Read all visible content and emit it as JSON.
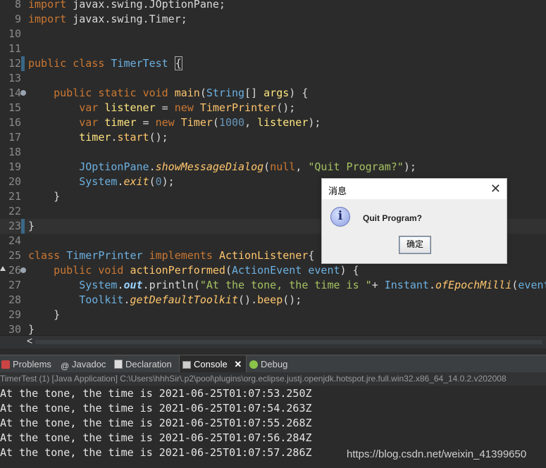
{
  "editor": {
    "lines": [
      {
        "num": "8"
      },
      {
        "num": "9"
      },
      {
        "num": "10"
      },
      {
        "num": "11"
      },
      {
        "num": "12"
      },
      {
        "num": "13"
      },
      {
        "num": "14"
      },
      {
        "num": "15"
      },
      {
        "num": "16"
      },
      {
        "num": "17"
      },
      {
        "num": "18"
      },
      {
        "num": "19"
      },
      {
        "num": "20"
      },
      {
        "num": "21"
      },
      {
        "num": "22"
      },
      {
        "num": "23"
      },
      {
        "num": "24"
      },
      {
        "num": "25"
      },
      {
        "num": "26"
      },
      {
        "num": "27"
      },
      {
        "num": "28"
      },
      {
        "num": "29"
      },
      {
        "num": "30"
      }
    ],
    "tokens": {
      "import": "import",
      "l8_rest": " javax.swing.JOptionPane;",
      "l9_rest": " javax.swing.Timer;",
      "public": "public",
      "class": "class",
      "TimerTest": "TimerTest",
      "brace_open_hl": "{",
      "static": "static",
      "void": "void",
      "main": "main",
      "String": "String",
      "args": "args",
      "var": "var",
      "listener": "listener",
      "new": "new",
      "TimerPrinter": "TimerPrinter",
      "timer": "timer",
      "Timer": "Timer",
      "n1000": "1000",
      "start": "start",
      "JOptionPane": "JOptionPane",
      "showMessageDialog": "showMessageDialog",
      "null": "null",
      "quit_str": "\"Quit Program?\"",
      "System": "System",
      "exit": "exit",
      "n0": "0",
      "implements": "implements",
      "ActionListener": "ActionListener",
      "actionPerformed": "actionPerformed",
      "ActionEvent": "ActionEvent",
      "event": "event",
      "out": "out",
      "println": "println",
      "tone_str": "\"At the tone, the time is \"",
      "Instant": "Instant",
      "ofEpochMilli": "ofEpochMilli",
      "event_trunc": "event",
      "Toolkit": "Toolkit",
      "getDefaultToolkit": "getDefaultToolkit",
      "beep": "beep"
    }
  },
  "scroll": {
    "left_arrow": "<"
  },
  "tabs": [
    {
      "label": "Problems",
      "icon": "problems-icon"
    },
    {
      "label": "Javadoc",
      "icon": "javadoc-icon"
    },
    {
      "label": "Declaration",
      "icon": "declaration-icon"
    },
    {
      "label": "Console",
      "icon": "console-icon",
      "active": true,
      "close": "✕"
    },
    {
      "label": "Debug",
      "icon": "debug-icon"
    }
  ],
  "console": {
    "status": "TimerTest (1) [Java Application] C:\\Users\\hhhSir\\.p2\\pool\\plugins\\org.eclipse.justj.openjdk.hotspot.jre.full.win32.x86_64_14.0.2.v202008",
    "lines": [
      "At the tone, the time is 2021-06-25T01:07:53.250Z",
      "At the tone, the time is 2021-06-25T01:07:54.263Z",
      "At the tone, the time is 2021-06-25T01:07:55.268Z",
      "At the tone, the time is 2021-06-25T01:07:56.284Z",
      "At the tone, the time is 2021-06-25T01:07:57.286Z"
    ]
  },
  "watermark": "https://blog.csdn.net/weixin_41399650",
  "dialog": {
    "title": "消息",
    "close": "✕",
    "icon": "info-icon",
    "icon_glyph": "i",
    "message": "Quit Program?",
    "ok_label": "确定"
  }
}
